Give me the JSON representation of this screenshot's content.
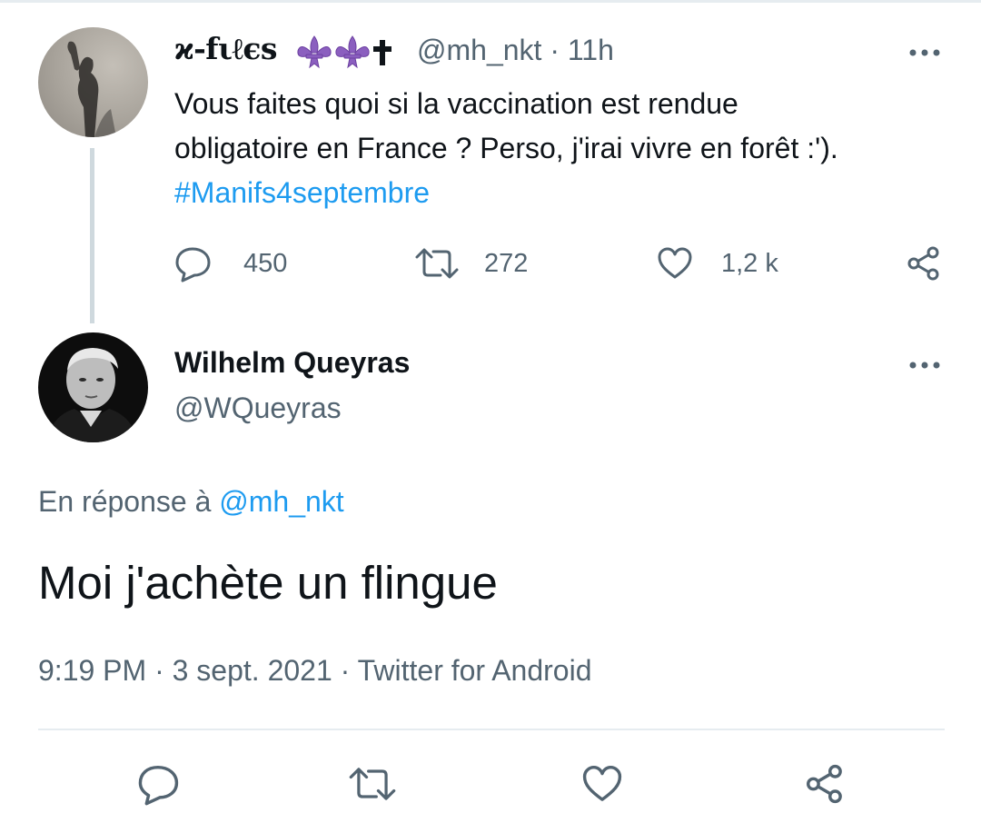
{
  "parent_tweet": {
    "display_name": "ϰ-fιℓєs",
    "badge_icons": [
      "fleur-de-lis-icon",
      "fleur-de-lis-icon",
      "cross-icon"
    ],
    "handle": "@mh_nkt",
    "separator": "·",
    "time": "11h",
    "text_lines": [
      "Vous faites quoi si la vaccination est rendue",
      "obligatoire en France ? Perso, j'irai vivre en forêt :')."
    ],
    "hashtag": "#Manifs4septembre",
    "stats": {
      "replies": "450",
      "retweets": "272",
      "likes": "1,2 k"
    }
  },
  "reply_tweet": {
    "display_name": "Wilhelm Queyras",
    "handle": "@WQueyras",
    "reply_prefix": "En réponse à",
    "reply_mention": "@mh_nkt",
    "text": "Moi j'achète un flingue",
    "meta": "9:19 PM · 3 sept. 2021 · Twitter for Android"
  },
  "colors": {
    "accent": "#1d9bf0",
    "secondary_text": "#536471",
    "fleur": "#8b5fbf",
    "divider": "#e6ecf0"
  }
}
